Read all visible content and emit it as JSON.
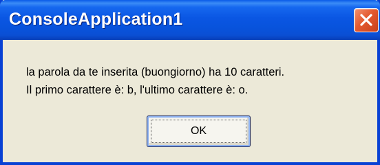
{
  "window": {
    "title": "ConsoleApplication1"
  },
  "titlebar": {
    "close_icon": "close-icon"
  },
  "message": {
    "line1": "la parola da te inserita (buongiorno) ha 10 caratteri.",
    "line2": "Il primo carattere è: b, l'ultimo carattere è: o."
  },
  "buttons": {
    "ok_label": "OK"
  },
  "colors": {
    "titlebar": "#0a56e3",
    "close_button": "#e45a30",
    "dialog_background": "#ece9d8"
  }
}
